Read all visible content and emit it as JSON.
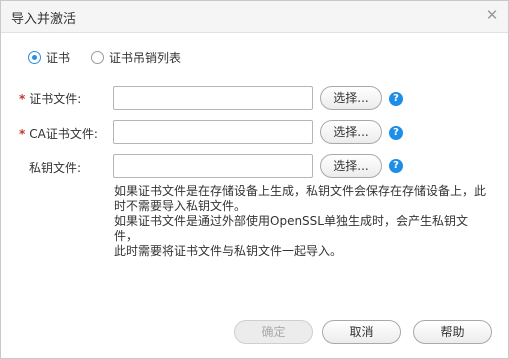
{
  "dialog": {
    "title": "导入并激活",
    "close_glyph": "✕"
  },
  "radios": [
    {
      "label": "证书",
      "checked": true
    },
    {
      "label": "证书吊销列表",
      "checked": false
    }
  ],
  "fields": [
    {
      "label": "证书文件:",
      "required": true,
      "value": "",
      "button": "选择...",
      "help": "?"
    },
    {
      "label": "CA证书文件:",
      "required": true,
      "value": "",
      "button": "选择...",
      "help": "?"
    },
    {
      "label": "私钥文件:",
      "required": false,
      "value": "",
      "button": "选择...",
      "help": "?"
    }
  ],
  "required_mark": "*",
  "note": {
    "line1": "如果证书文件是在存储设备上生成，私钥文件会保存在存储设备上，此",
    "line2": "时不需要导入私钥文件。",
    "line3": "如果证书文件是通过外部使用OpenSSL单独生成时，会产生私钥文件，",
    "line4": "此时需要将证书文件与私钥文件一起导入。"
  },
  "footer": {
    "ok": "确定",
    "cancel": "取消",
    "help": "帮助"
  },
  "colors": {
    "accent": "#2d8ee0",
    "help_icon": "#1e8fe6",
    "required": "#c0392b"
  }
}
